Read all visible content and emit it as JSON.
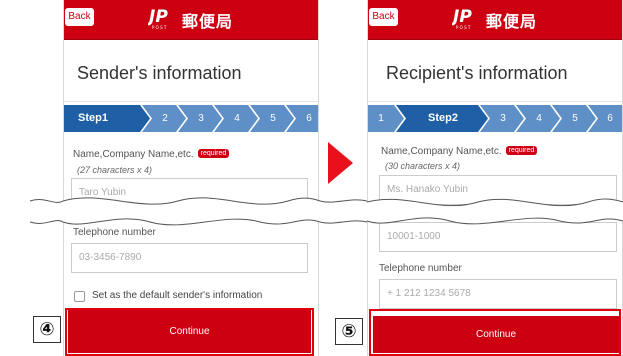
{
  "colors": {
    "brand_red": "#cc0011",
    "step_active": "#1f5fa5",
    "step_inactive": "#5e8fc6"
  },
  "header": {
    "back_label": "Back",
    "logo_text": "郵便局",
    "logo_icon": "jp-post-logo-icon"
  },
  "left_screen": {
    "title": "Sender's information",
    "steps": [
      {
        "label": "Step1",
        "active": true
      },
      {
        "label": "2",
        "active": false
      },
      {
        "label": "3",
        "active": false
      },
      {
        "label": "4",
        "active": false
      },
      {
        "label": "5",
        "active": false
      },
      {
        "label": "6",
        "active": false
      }
    ],
    "name_field": {
      "label": "Name,Company Name,etc.",
      "required_badge": "required",
      "hint": "(27 characters x 4)",
      "placeholder": "Taro Yubin"
    },
    "phone_field": {
      "label": "Telephone number",
      "placeholder": "03-3456-7890"
    },
    "default_checkbox_label": "Set as the default sender's information",
    "continue_label": "Continue",
    "marker": "④"
  },
  "right_screen": {
    "title": "Recipient's information",
    "steps": [
      {
        "label": "1",
        "active": false
      },
      {
        "label": "Step2",
        "active": true
      },
      {
        "label": "3",
        "active": false
      },
      {
        "label": "4",
        "active": false
      },
      {
        "label": "5",
        "active": false
      },
      {
        "label": "6",
        "active": false
      }
    ],
    "name_field": {
      "label": "Name,Company Name,etc.",
      "required_badge": "required",
      "hint": "(30 characters x 4)",
      "placeholder": "Ms. Hanako Yubin"
    },
    "zip_placeholder": "10001-1000",
    "phone_field": {
      "label": "Telephone number",
      "placeholder": "+ 1 212 1234 5678"
    },
    "continue_label": "Continue",
    "marker": "⑤"
  }
}
